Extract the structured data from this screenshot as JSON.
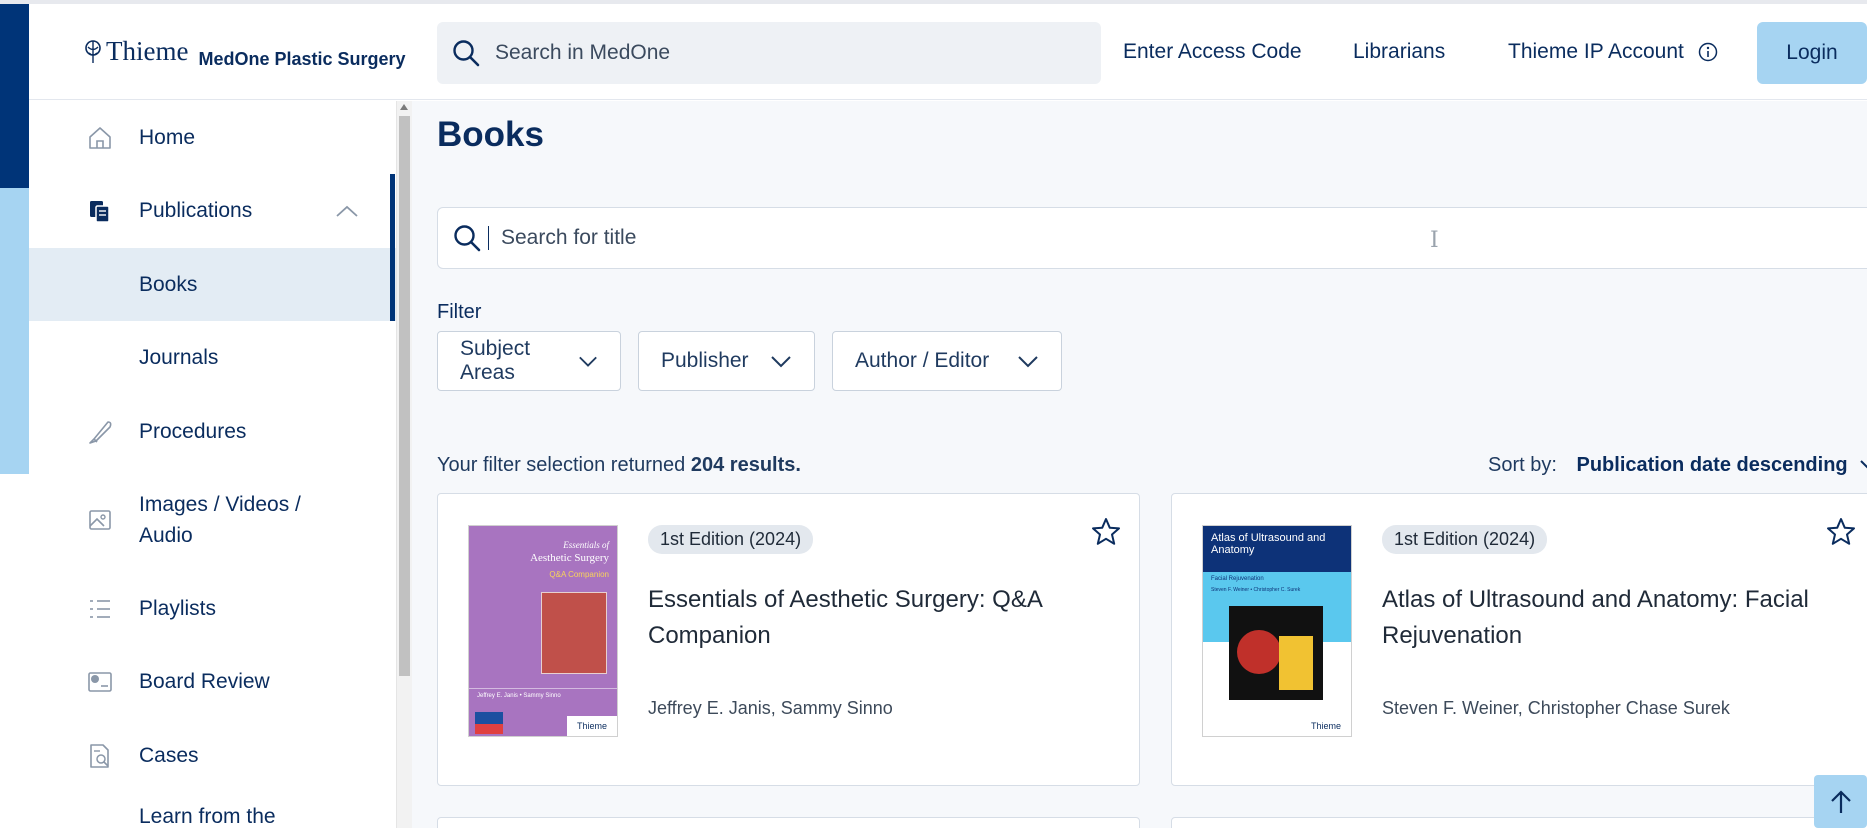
{
  "header": {
    "brand": "Thieme",
    "product": "MedOne Plastic Surgery",
    "search_placeholder": "Search in MedOne",
    "links": [
      "Enter Access Code",
      "Librarians",
      "Thieme IP Account"
    ],
    "login_label": "Login"
  },
  "sidebar": {
    "items": [
      {
        "label": "Home",
        "icon": "home-icon"
      },
      {
        "label": "Publications",
        "icon": "publications-icon"
      },
      {
        "label": "Books",
        "icon": ""
      },
      {
        "label": "Journals",
        "icon": ""
      },
      {
        "label": "Procedures",
        "icon": "scalpel-icon"
      },
      {
        "label": "Images / Videos /",
        "label2": "Audio",
        "icon": "image-icon"
      },
      {
        "label": "Playlists",
        "icon": "list-icon"
      },
      {
        "label": "Board Review",
        "icon": "board-review-icon"
      },
      {
        "label": "Cases",
        "icon": "cases-icon"
      },
      {
        "label": "Learn from the",
        "icon": ""
      }
    ]
  },
  "main": {
    "title": "Books",
    "search_placeholder": "Search for title",
    "filter_label": "Filter",
    "filters": [
      "Subject Areas",
      "Publisher",
      "Author / Editor"
    ],
    "result_prefix": "Your filter selection returned ",
    "result_count": "204 results.",
    "sort_label": "Sort by:",
    "sort_value": "Publication date descending",
    "cards": [
      {
        "edition": "1st Edition (2024)",
        "title": "Essentials of Aesthetic Surgery: Q&A Companion",
        "authors": "Jeffrey E. Janis, Sammy Sinno",
        "cover_title": "Aesthetic Surgery",
        "cover_pre": "Essentials of",
        "cover_sub": "Q&A Companion",
        "cover_authors": "Jeffrey E. Janis • Sammy Sinno",
        "cover_publisher": "Thieme"
      },
      {
        "edition": "1st Edition (2024)",
        "title": "Atlas of Ultrasound and Anatomy: Facial Rejuvenation",
        "authors": "Steven F. Weiner, Christopher Chase Surek",
        "cover_title": "Atlas of Ultrasound and Anatomy",
        "cover_sub": "Facial Rejuvenation",
        "cover_authors": "Steven F. Weiner • Christopher C. Surek",
        "cover_publisher": "Thieme"
      }
    ]
  },
  "colors": {
    "brand_dark": "#003478",
    "brand_light": "#a6d4f2",
    "cover1_bg": "#a874c0",
    "cover2_top": "#0d3278",
    "cover2_mid": "#5ac8ee"
  }
}
